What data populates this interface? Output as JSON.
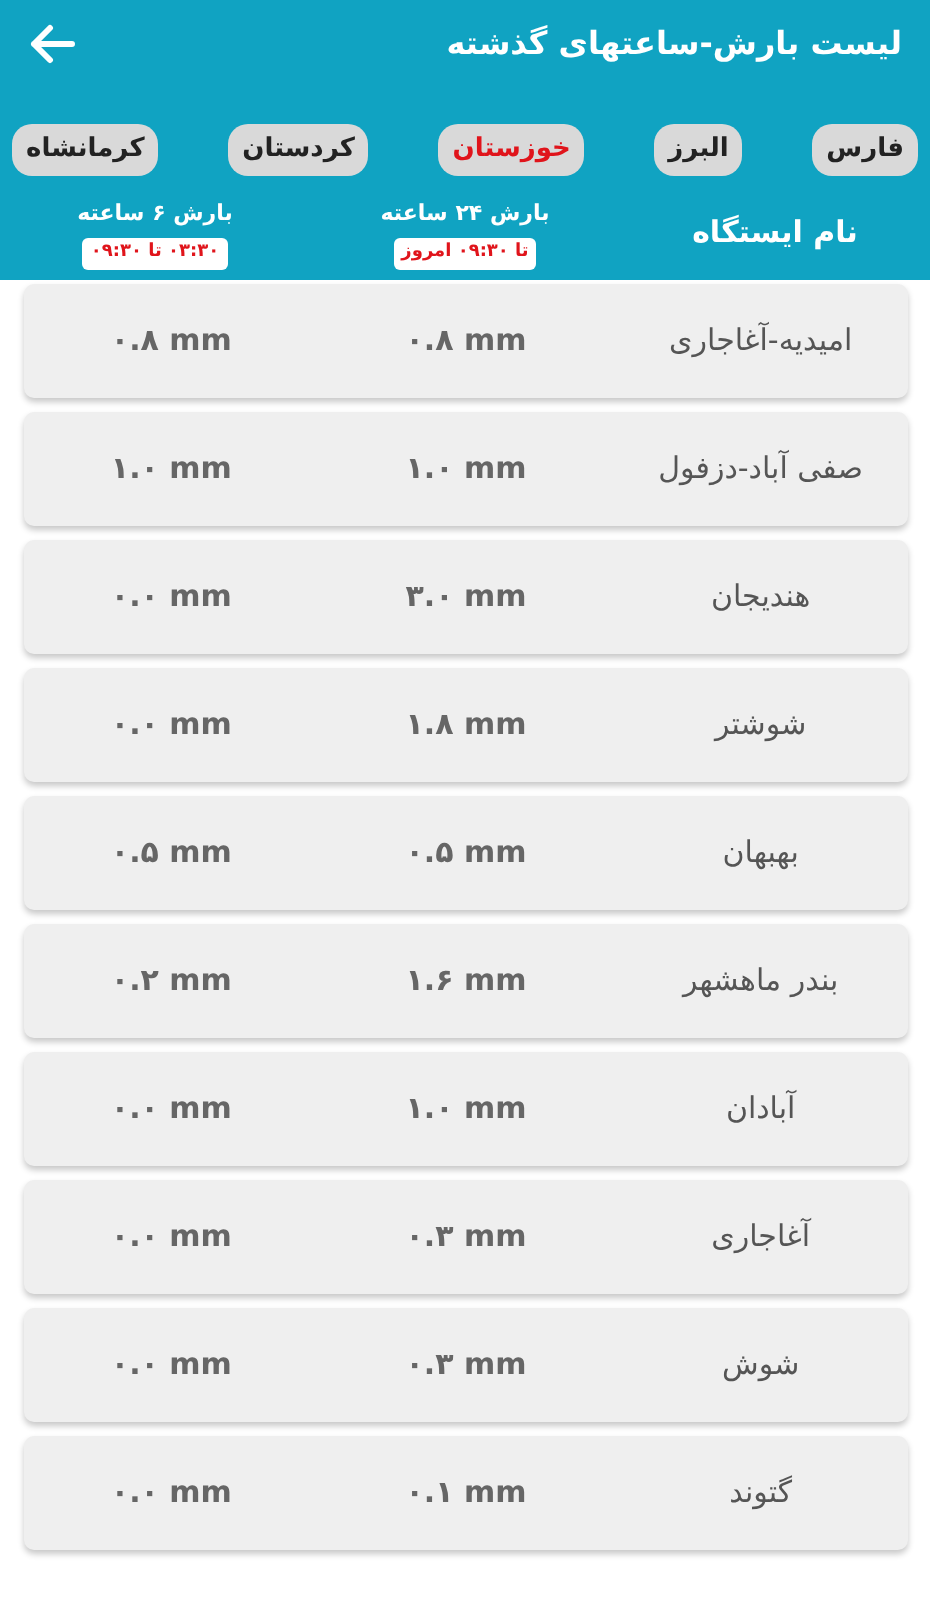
{
  "app_bar": {
    "title": "لیست بارش-ساعتهای گذشته"
  },
  "tabs": [
    {
      "label": "فارس",
      "selected": false
    },
    {
      "label": "البرز",
      "selected": false
    },
    {
      "label": "خوزستان",
      "selected": true
    },
    {
      "label": "کردستان",
      "selected": false
    },
    {
      "label": "کرمانشاه",
      "selected": false
    }
  ],
  "table": {
    "columns": [
      {
        "title": "نام ایستگاه"
      },
      {
        "title": "بارش ۲۴ ساعته",
        "badge": "تا ۰۹:۳۰ امروز"
      },
      {
        "title": "بارش ۶ ساعته",
        "badge": "۰۳:۳۰ تا ۰۹:۳۰"
      }
    ],
    "rows": [
      {
        "station": "امیدیه-آغاجاری",
        "rain_24h": "۰.۸ mm",
        "rain_6h": "۰.۸ mm"
      },
      {
        "station": "صفی آباد-دزفول",
        "rain_24h": "۱.۰ mm",
        "rain_6h": "۱.۰ mm"
      },
      {
        "station": "هندیجان",
        "rain_24h": "۳.۰ mm",
        "rain_6h": "۰.۰ mm"
      },
      {
        "station": "شوشتر",
        "rain_24h": "۱.۸ mm",
        "rain_6h": "۰.۰ mm"
      },
      {
        "station": "بهبهان",
        "rain_24h": "۰.۵ mm",
        "rain_6h": "۰.۵ mm"
      },
      {
        "station": "بندر ماهشهر",
        "rain_24h": "۱.۶ mm",
        "rain_6h": "۰.۲ mm"
      },
      {
        "station": "آبادان",
        "rain_24h": "۱.۰ mm",
        "rain_6h": "۰.۰ mm"
      },
      {
        "station": "آغاجاری",
        "rain_24h": "۰.۳ mm",
        "rain_6h": "۰.۰ mm"
      },
      {
        "station": "شوش",
        "rain_24h": "۰.۳ mm",
        "rain_6h": "۰.۰ mm"
      },
      {
        "station": "گتوند",
        "rain_24h": "۰.۱ mm",
        "rain_6h": "۰.۰ mm"
      }
    ]
  }
}
